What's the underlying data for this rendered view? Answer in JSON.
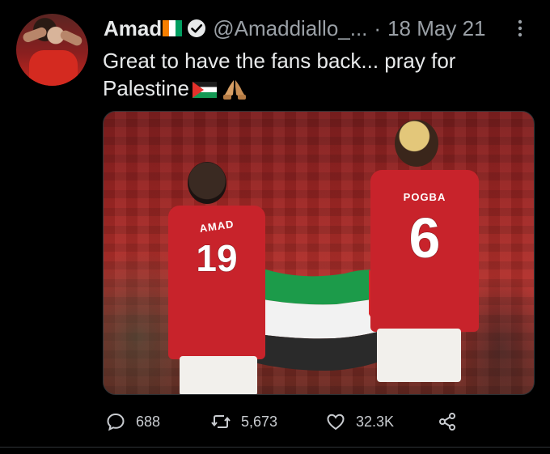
{
  "user": {
    "display_name": "Amad",
    "handle": "@Amaddiallo_...",
    "separator": "·",
    "date": "18 May 21"
  },
  "tweet": {
    "line1": "Great to have the fans back... pray for",
    "line2": "Palestine"
  },
  "media": {
    "left_player": {
      "name": "AMAD",
      "number": "19"
    },
    "right_player": {
      "name": "POGBA",
      "number": "6"
    }
  },
  "actions": {
    "replies": "688",
    "retweets": "5,673",
    "likes": "32.3K"
  },
  "icons": {
    "verified": "verified-badge-icon",
    "more": "more-icon",
    "reply": "reply-icon",
    "retweet": "retweet-icon",
    "like": "heart-icon",
    "share": "share-icon"
  },
  "colors": {
    "background": "#000000",
    "text": "#e7e9ea",
    "muted": "#9aa0a6",
    "jersey_red": "#c8232b"
  }
}
